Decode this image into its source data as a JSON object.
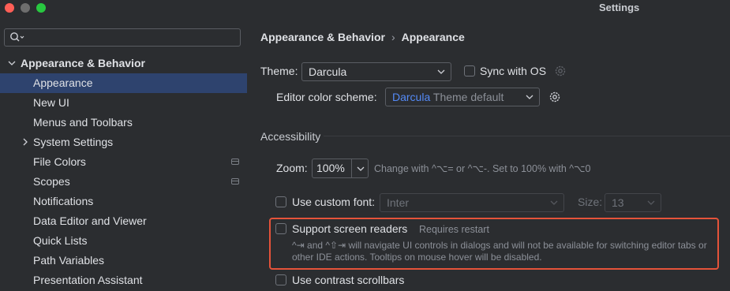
{
  "window": {
    "title": "Settings"
  },
  "search": {
    "placeholder": ""
  },
  "sidebar": {
    "items": [
      {
        "label": "Appearance & Behavior"
      },
      {
        "label": "Appearance"
      },
      {
        "label": "New UI"
      },
      {
        "label": "Menus and Toolbars"
      },
      {
        "label": "System Settings"
      },
      {
        "label": "File Colors"
      },
      {
        "label": "Scopes"
      },
      {
        "label": "Notifications"
      },
      {
        "label": "Data Editor and Viewer"
      },
      {
        "label": "Quick Lists"
      },
      {
        "label": "Path Variables"
      },
      {
        "label": "Presentation Assistant"
      }
    ]
  },
  "breadcrumb": {
    "parent": "Appearance & Behavior",
    "separator": "›",
    "current": "Appearance"
  },
  "theme": {
    "label": "Theme:",
    "value": "Darcula",
    "sync_label": "Sync with OS"
  },
  "editor_scheme": {
    "label": "Editor color scheme:",
    "value_accent": "Darcula",
    "value_rest": "Theme default"
  },
  "accessibility": {
    "title": "Accessibility",
    "zoom_label": "Zoom:",
    "zoom_value": "100%",
    "zoom_hint": "Change with ^⌥= or ^⌥-. Set to 100% with ^⌥0",
    "custom_font_label": "Use custom font:",
    "font_value": "Inter",
    "size_label": "Size:",
    "size_value": "13",
    "screen_readers_label": "Support screen readers",
    "requires_restart": "Requires restart",
    "screen_readers_desc": "^⇥ and ^⇧⇥ will navigate UI controls in dialogs and will not be available for switching editor tabs or other IDE actions. Tooltips on mouse hover will be disabled.",
    "contrast_scrollbars_label": "Use contrast scrollbars"
  },
  "colors": {
    "selection": "#2e436e",
    "accent_link": "#548af7",
    "highlight": "#e5533a"
  }
}
